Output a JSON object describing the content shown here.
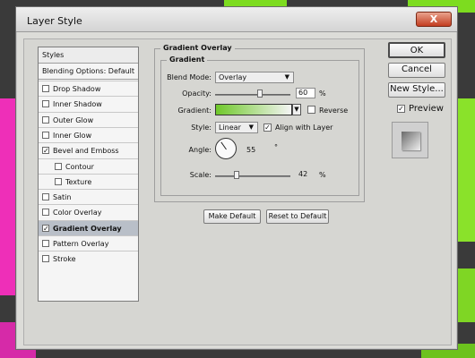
{
  "window": {
    "title": "Layer Style",
    "close_label": "X"
  },
  "styles_panel": {
    "header": "Styles",
    "blending_options": "Blending Options: Default",
    "items": [
      {
        "label": "Drop Shadow",
        "checked": false
      },
      {
        "label": "Inner Shadow",
        "checked": false
      },
      {
        "label": "Outer Glow",
        "checked": false
      },
      {
        "label": "Inner Glow",
        "checked": false
      },
      {
        "label": "Bevel and Emboss",
        "checked": true
      },
      {
        "label": "Contour",
        "checked": false
      },
      {
        "label": "Texture",
        "checked": false
      },
      {
        "label": "Satin",
        "checked": false
      },
      {
        "label": "Color Overlay",
        "checked": false
      },
      {
        "label": "Gradient Overlay",
        "checked": true
      },
      {
        "label": "Pattern Overlay",
        "checked": false
      },
      {
        "label": "Stroke",
        "checked": false
      }
    ]
  },
  "gradient_overlay": {
    "title": "Gradient Overlay",
    "subgroup_title": "Gradient",
    "blend_mode_label": "Blend Mode:",
    "blend_mode_value": "Overlay",
    "opacity_label": "Opacity:",
    "opacity_value": "60",
    "opacity_unit": "%",
    "gradient_label": "Gradient:",
    "reverse_label": "Reverse",
    "reverse_checked": false,
    "style_label": "Style:",
    "style_value": "Linear",
    "align_label": "Align with Layer",
    "align_checked": true,
    "angle_label": "Angle:",
    "angle_value": "55",
    "angle_unit": "°",
    "scale_label": "Scale:",
    "scale_value": "42",
    "scale_unit": "%"
  },
  "buttons": {
    "make_default": "Make Default",
    "reset_default": "Reset to Default",
    "ok": "OK",
    "cancel": "Cancel",
    "new_style": "New Style...",
    "preview_label": "Preview",
    "preview_checked": true
  },
  "colors": {
    "gradient_start": "#6fc82a",
    "gradient_end": "#f4f4f4",
    "wallpaper_lime": "#7ddc1f",
    "wallpaper_pink": "#ee2fb8"
  }
}
